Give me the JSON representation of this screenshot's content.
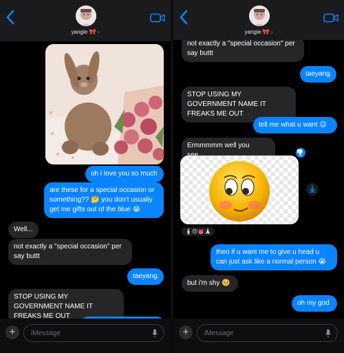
{
  "conversation": {
    "contact_name": "yangie",
    "contact_emoji": "🎀",
    "contact_chevron": "›"
  },
  "left_panel": {
    "messages": [
      {
        "from": "me",
        "text": "oh i love you so much"
      },
      {
        "from": "me",
        "text": "are these for a special occasion or something?? 🤔 you don't usually get me gifts out of the blue 😭"
      },
      {
        "from": "them",
        "text": "Well..."
      },
      {
        "from": "them",
        "text": "not exactly a \"special occasion\" per say buttt"
      },
      {
        "from": "me",
        "text": "taeyang."
      },
      {
        "from": "them",
        "text": "STOP USING MY GOVERNMENT NAME IT FREAKS ME OUT"
      }
    ]
  },
  "right_panel": {
    "messages": [
      {
        "from": "them",
        "text": "not exactly a \"special occasion\" per say buttt"
      },
      {
        "from": "me",
        "text": "taeyang."
      },
      {
        "from": "them",
        "text": "STOP USING MY GOVERNMENT NAME IT FREAKS ME OUT"
      },
      {
        "from": "me",
        "text": "tell me what u want 😉"
      },
      {
        "from": "them",
        "text": "Ermmmmm well you see...."
      },
      {
        "from": "them",
        "text": "👎🏻",
        "kind": "reaction"
      },
      {
        "from": "them",
        "text": "🕯️😞👅🙏🏻",
        "kind": "tapback-list"
      },
      {
        "from": "me",
        "text": "theo if u want me to give u head u can just ask like a normal person 😭"
      },
      {
        "from": "them",
        "text": "but i'm shy 🥺"
      },
      {
        "from": "me",
        "text": "oh my god"
      }
    ]
  },
  "composer": {
    "placeholder": "iMessage",
    "plus_label": "+"
  },
  "icons": {
    "back": "chevron-left-icon",
    "video": "video-camera-icon",
    "mic": "microphone-icon",
    "save": "save-download-icon"
  },
  "colors": {
    "outgoing": "#0a84ff",
    "incoming": "#262628",
    "header": "#1b1b1d",
    "accent": "#0a84ff"
  }
}
